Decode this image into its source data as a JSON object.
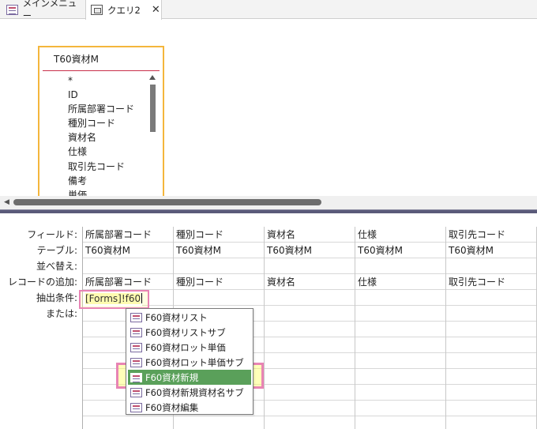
{
  "tabs": [
    {
      "label": "メインメニュー",
      "icon": "form-icon",
      "active": false
    },
    {
      "label": "クエリ2",
      "icon": "query-icon",
      "active": true,
      "close": "✕"
    }
  ],
  "field_list": {
    "title": "T60資材M",
    "items": [
      "*",
      "ID",
      "所属部署コード",
      "種別コード",
      "資材名",
      "仕様",
      "取引先コード",
      "備考",
      "単価"
    ]
  },
  "grid": {
    "row_labels": [
      "フィールド:",
      "テーブル:",
      "並べ替え:",
      "レコードの追加:",
      "抽出条件:",
      "または:"
    ],
    "columns": [
      {
        "field": "所属部署コード",
        "table": "T60資材M",
        "append": "所属部署コード"
      },
      {
        "field": "種別コード",
        "table": "T60資材M",
        "append": "種別コード"
      },
      {
        "field": "資材名",
        "table": "T60資材M",
        "append": "資材名"
      },
      {
        "field": "仕様",
        "table": "T60資材M",
        "append": "仕様"
      },
      {
        "field": "取引先コード",
        "table": "T60資材M",
        "append": "取引先コード"
      }
    ],
    "criteria_text": "[Forms]!f60"
  },
  "autocomplete": {
    "items": [
      "F60資材リスト",
      "F60資材リストサブ",
      "F60資材ロット単価",
      "F60資材ロット単価サブ",
      "F60資材新規",
      "F60資材新規資材名サブ",
      "F60資材編集"
    ],
    "selected_index": 4
  },
  "colors": {
    "field_list_border": "#f4b63c",
    "highlight_box": "#e884b4",
    "selected_item_bg": "#5aa05a"
  }
}
